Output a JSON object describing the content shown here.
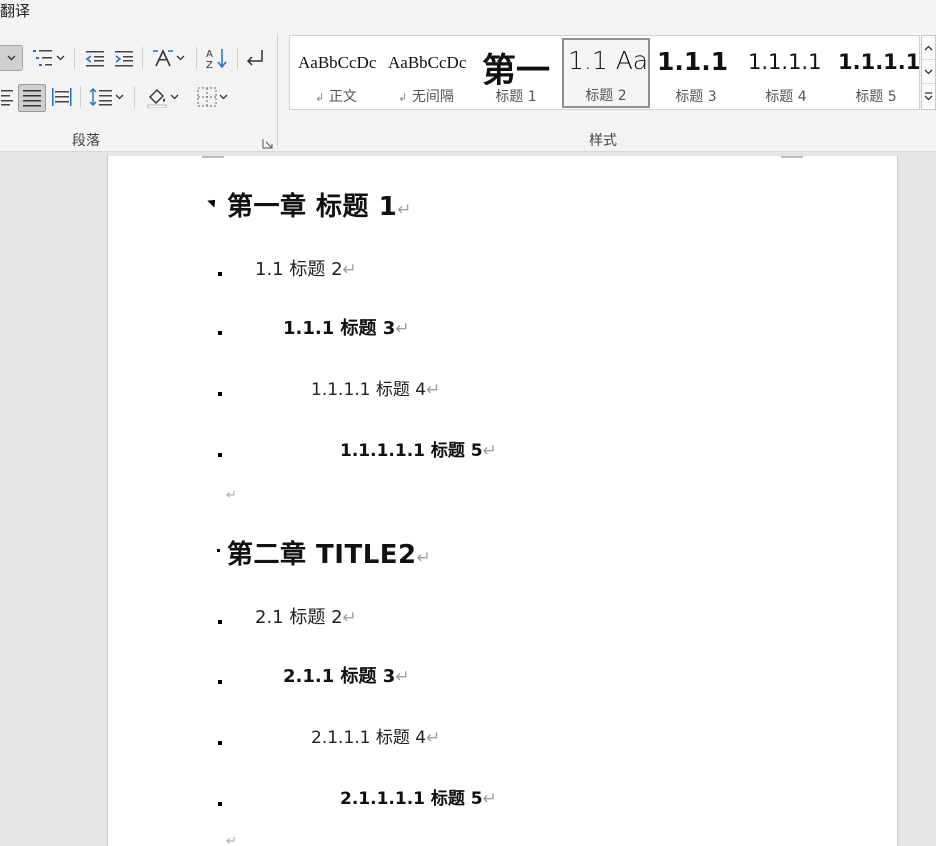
{
  "ribbon": {
    "top_label": "翻译",
    "paragraph_group_label": "段落",
    "styles_group_label": "样式",
    "styles": [
      {
        "preview": "AaBbCcDc",
        "name": "正文",
        "mark": "↲"
      },
      {
        "preview": "AaBbCcDc",
        "name": "无间隔",
        "mark": "↲"
      },
      {
        "preview": "第一",
        "name": "标题 1",
        "mark": ""
      },
      {
        "preview": "1.1  Aa",
        "name": "标题 2",
        "mark": "",
        "selected": true
      },
      {
        "preview": "1.1.1",
        "name": "标题 3",
        "mark": ""
      },
      {
        "preview": "1.1.1.1",
        "name": "标题 4",
        "mark": ""
      },
      {
        "preview": "1.1.1.1.",
        "name": "标题 5",
        "mark": ""
      }
    ]
  },
  "document": {
    "chapter1": {
      "title": "第一章   标题 1",
      "h2": "1.1  标题 2",
      "h3": "1.1.1  标题 3",
      "h4": "1.1.1.1 标题 4",
      "h5": "1.1.1.1.1  标题 5"
    },
    "chapter2": {
      "title": "第二章   TITLE2",
      "h2": "2.1  标题 2",
      "h3": "2.1.1  标题 3",
      "h4": "2.1.1.1 标题 4",
      "h5": "2.1.1.1.1  标题 5"
    },
    "paragraph_mark": "↵"
  }
}
